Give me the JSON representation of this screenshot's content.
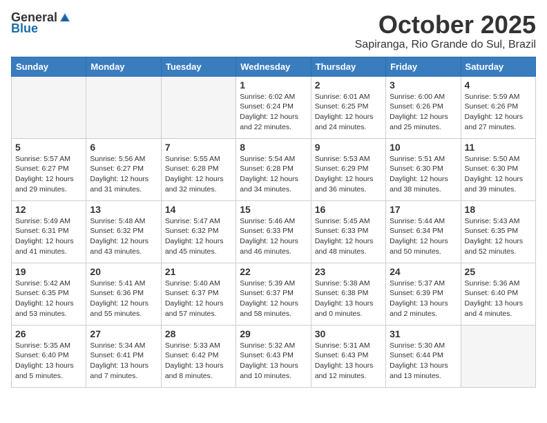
{
  "logo": {
    "general": "General",
    "blue": "Blue"
  },
  "title": "October 2025",
  "location": "Sapiranga, Rio Grande do Sul, Brazil",
  "weekdays": [
    "Sunday",
    "Monday",
    "Tuesday",
    "Wednesday",
    "Thursday",
    "Friday",
    "Saturday"
  ],
  "weeks": [
    [
      {
        "day": "",
        "info": ""
      },
      {
        "day": "",
        "info": ""
      },
      {
        "day": "",
        "info": ""
      },
      {
        "day": "1",
        "info": "Sunrise: 6:02 AM\nSunset: 6:24 PM\nDaylight: 12 hours\nand 22 minutes."
      },
      {
        "day": "2",
        "info": "Sunrise: 6:01 AM\nSunset: 6:25 PM\nDaylight: 12 hours\nand 24 minutes."
      },
      {
        "day": "3",
        "info": "Sunrise: 6:00 AM\nSunset: 6:26 PM\nDaylight: 12 hours\nand 25 minutes."
      },
      {
        "day": "4",
        "info": "Sunrise: 5:59 AM\nSunset: 6:26 PM\nDaylight: 12 hours\nand 27 minutes."
      }
    ],
    [
      {
        "day": "5",
        "info": "Sunrise: 5:57 AM\nSunset: 6:27 PM\nDaylight: 12 hours\nand 29 minutes."
      },
      {
        "day": "6",
        "info": "Sunrise: 5:56 AM\nSunset: 6:27 PM\nDaylight: 12 hours\nand 31 minutes."
      },
      {
        "day": "7",
        "info": "Sunrise: 5:55 AM\nSunset: 6:28 PM\nDaylight: 12 hours\nand 32 minutes."
      },
      {
        "day": "8",
        "info": "Sunrise: 5:54 AM\nSunset: 6:28 PM\nDaylight: 12 hours\nand 34 minutes."
      },
      {
        "day": "9",
        "info": "Sunrise: 5:53 AM\nSunset: 6:29 PM\nDaylight: 12 hours\nand 36 minutes."
      },
      {
        "day": "10",
        "info": "Sunrise: 5:51 AM\nSunset: 6:30 PM\nDaylight: 12 hours\nand 38 minutes."
      },
      {
        "day": "11",
        "info": "Sunrise: 5:50 AM\nSunset: 6:30 PM\nDaylight: 12 hours\nand 39 minutes."
      }
    ],
    [
      {
        "day": "12",
        "info": "Sunrise: 5:49 AM\nSunset: 6:31 PM\nDaylight: 12 hours\nand 41 minutes."
      },
      {
        "day": "13",
        "info": "Sunrise: 5:48 AM\nSunset: 6:32 PM\nDaylight: 12 hours\nand 43 minutes."
      },
      {
        "day": "14",
        "info": "Sunrise: 5:47 AM\nSunset: 6:32 PM\nDaylight: 12 hours\nand 45 minutes."
      },
      {
        "day": "15",
        "info": "Sunrise: 5:46 AM\nSunset: 6:33 PM\nDaylight: 12 hours\nand 46 minutes."
      },
      {
        "day": "16",
        "info": "Sunrise: 5:45 AM\nSunset: 6:33 PM\nDaylight: 12 hours\nand 48 minutes."
      },
      {
        "day": "17",
        "info": "Sunrise: 5:44 AM\nSunset: 6:34 PM\nDaylight: 12 hours\nand 50 minutes."
      },
      {
        "day": "18",
        "info": "Sunrise: 5:43 AM\nSunset: 6:35 PM\nDaylight: 12 hours\nand 52 minutes."
      }
    ],
    [
      {
        "day": "19",
        "info": "Sunrise: 5:42 AM\nSunset: 6:35 PM\nDaylight: 12 hours\nand 53 minutes."
      },
      {
        "day": "20",
        "info": "Sunrise: 5:41 AM\nSunset: 6:36 PM\nDaylight: 12 hours\nand 55 minutes."
      },
      {
        "day": "21",
        "info": "Sunrise: 5:40 AM\nSunset: 6:37 PM\nDaylight: 12 hours\nand 57 minutes."
      },
      {
        "day": "22",
        "info": "Sunrise: 5:39 AM\nSunset: 6:37 PM\nDaylight: 12 hours\nand 58 minutes."
      },
      {
        "day": "23",
        "info": "Sunrise: 5:38 AM\nSunset: 6:38 PM\nDaylight: 13 hours\nand 0 minutes."
      },
      {
        "day": "24",
        "info": "Sunrise: 5:37 AM\nSunset: 6:39 PM\nDaylight: 13 hours\nand 2 minutes."
      },
      {
        "day": "25",
        "info": "Sunrise: 5:36 AM\nSunset: 6:40 PM\nDaylight: 13 hours\nand 4 minutes."
      }
    ],
    [
      {
        "day": "26",
        "info": "Sunrise: 5:35 AM\nSunset: 6:40 PM\nDaylight: 13 hours\nand 5 minutes."
      },
      {
        "day": "27",
        "info": "Sunrise: 5:34 AM\nSunset: 6:41 PM\nDaylight: 13 hours\nand 7 minutes."
      },
      {
        "day": "28",
        "info": "Sunrise: 5:33 AM\nSunset: 6:42 PM\nDaylight: 13 hours\nand 8 minutes."
      },
      {
        "day": "29",
        "info": "Sunrise: 5:32 AM\nSunset: 6:43 PM\nDaylight: 13 hours\nand 10 minutes."
      },
      {
        "day": "30",
        "info": "Sunrise: 5:31 AM\nSunset: 6:43 PM\nDaylight: 13 hours\nand 12 minutes."
      },
      {
        "day": "31",
        "info": "Sunrise: 5:30 AM\nSunset: 6:44 PM\nDaylight: 13 hours\nand 13 minutes."
      },
      {
        "day": "",
        "info": ""
      }
    ]
  ]
}
